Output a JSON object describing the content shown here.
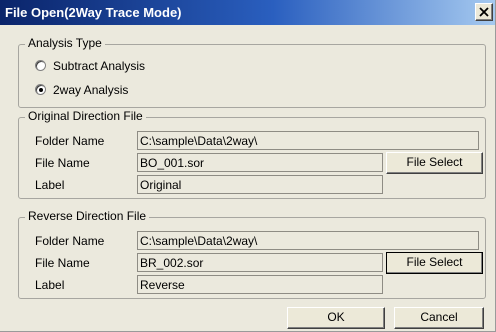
{
  "window": {
    "title": "File Open(2Way Trace Mode)",
    "close_glyph": "close-icon"
  },
  "analysis": {
    "legend": "Analysis Type",
    "options": [
      {
        "label": "Subtract Analysis",
        "selected": false
      },
      {
        "label": "2way  Analysis",
        "selected": true
      }
    ]
  },
  "original": {
    "legend": "Original Direction File",
    "folder_label": "Folder Name",
    "folder_value": "C:\\sample\\Data\\2way\\",
    "file_label": "File Name",
    "file_value": "BO_001.sor",
    "label_label": "Label",
    "label_value": "Original",
    "select_button": "File Select"
  },
  "reverse": {
    "legend": "Reverse Direction File",
    "folder_label": "Folder Name",
    "folder_value": "C:\\sample\\Data\\2way\\",
    "file_label": "File Name",
    "file_value": "BR_002.sor",
    "label_label": "Label",
    "label_value": "Reverse",
    "select_button": "File Select"
  },
  "footer": {
    "ok": "OK",
    "cancel": "Cancel"
  }
}
